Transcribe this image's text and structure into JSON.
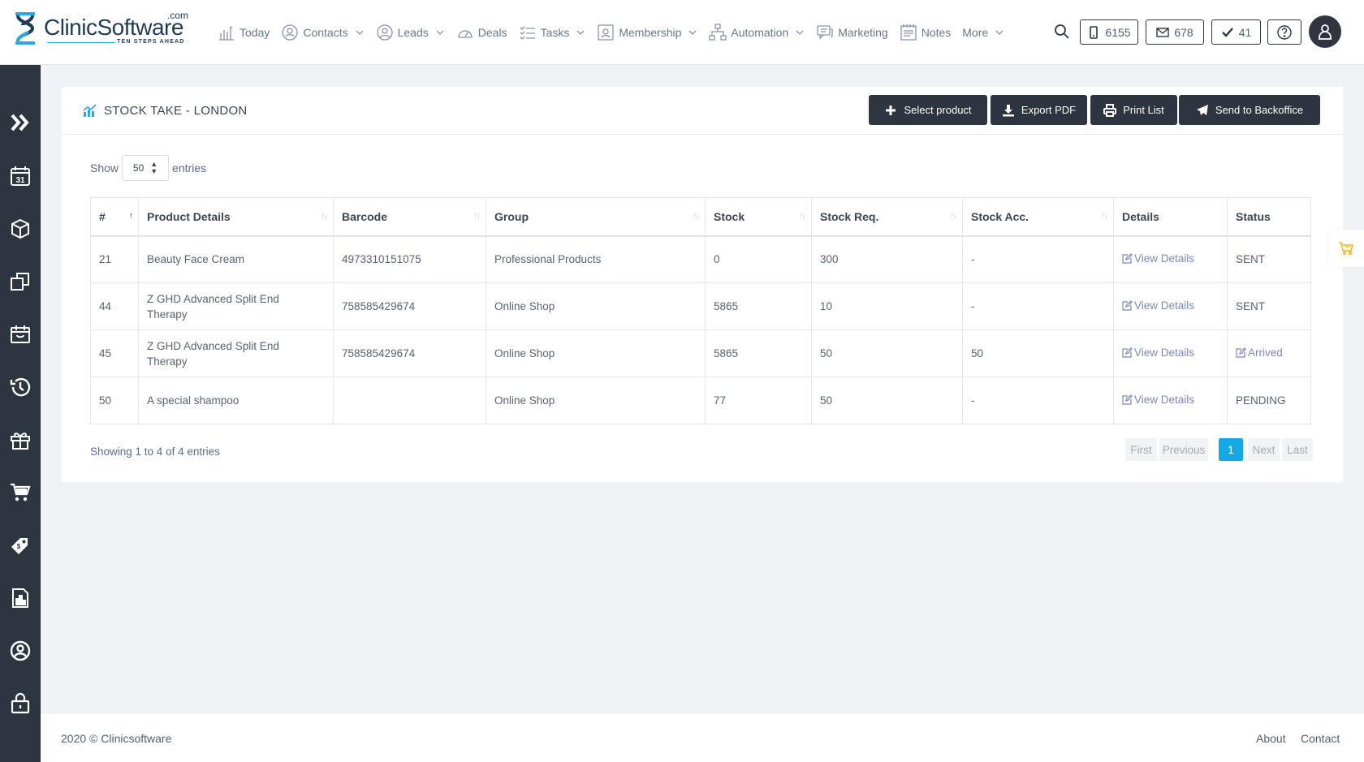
{
  "brand": {
    "name": "ClinicSoftware",
    "dotcom": ".com",
    "tagline": "TEN STEPS AHEAD"
  },
  "nav": [
    {
      "label": "Today",
      "icon": "bar-chart-icon",
      "dropdown": false
    },
    {
      "label": "Contacts",
      "icon": "users-icon",
      "dropdown": true
    },
    {
      "label": "Leads",
      "icon": "user-circle-icon",
      "dropdown": true
    },
    {
      "label": "Deals",
      "icon": "gauge-icon",
      "dropdown": false
    },
    {
      "label": "Tasks",
      "icon": "checklist-icon",
      "dropdown": true
    },
    {
      "label": "Membership",
      "icon": "membership-card-icon",
      "dropdown": true
    },
    {
      "label": "Automation",
      "icon": "flow-icon",
      "dropdown": true
    },
    {
      "label": "Marketing",
      "icon": "chat-icon",
      "dropdown": false
    },
    {
      "label": "Notes",
      "icon": "notes-icon",
      "dropdown": false
    },
    {
      "label": "More",
      "icon": "",
      "dropdown": true
    }
  ],
  "counters": {
    "sms": "6155",
    "email": "678",
    "tasks": "41"
  },
  "page": {
    "title": "STOCK TAKE - LONDON",
    "buttons": {
      "select_product": "Select product",
      "export_pdf": "Export PDF",
      "print_list": "Print List",
      "send_backoffice": "Send to Backoffice"
    },
    "show_label": "Show",
    "entries_label": "entries",
    "page_size": "50"
  },
  "table": {
    "headers": [
      "#",
      "Product Details",
      "Barcode",
      "Group",
      "Stock",
      "Stock Req.",
      "Stock Acc.",
      "Details",
      "Status"
    ],
    "rows": [
      {
        "id": "21",
        "product": "Beauty Face Cream",
        "barcode": "4973310151075",
        "group": "Professional Products",
        "stock": "0",
        "stock_req": "300",
        "stock_acc": "-",
        "details": "View Details",
        "status": "SENT"
      },
      {
        "id": "44",
        "product": "Z GHD Advanced Split End Therapy",
        "barcode": "758585429674",
        "group": "Online Shop",
        "stock": "5865",
        "stock_req": "10",
        "stock_acc": "-",
        "details": "View Details",
        "status": "SENT"
      },
      {
        "id": "45",
        "product": "Z GHD Advanced Split End Therapy",
        "barcode": "758585429674",
        "group": "Online Shop",
        "stock": "5865",
        "stock_req": "50",
        "stock_acc": "50",
        "details": "View Details",
        "status": "Arrived"
      },
      {
        "id": "50",
        "product": "A special shampoo",
        "barcode": "",
        "group": "Online Shop",
        "stock": "77",
        "stock_req": "50",
        "stock_acc": "-",
        "details": "View Details",
        "status": "PENDING"
      }
    ]
  },
  "info": "Showing 1 to 4 of 4 entries",
  "pagination": {
    "first": "First",
    "previous": "Previous",
    "current": "1",
    "next": "Next",
    "last": "Last"
  },
  "footer": {
    "copyright": "2020 © Clinicsoftware",
    "about": "About",
    "contact": "Contact"
  },
  "colors": {
    "sidebar": "#2d3640",
    "accent": "#14a9e6",
    "link": "#7d88b3",
    "cart": "#f0b323"
  }
}
